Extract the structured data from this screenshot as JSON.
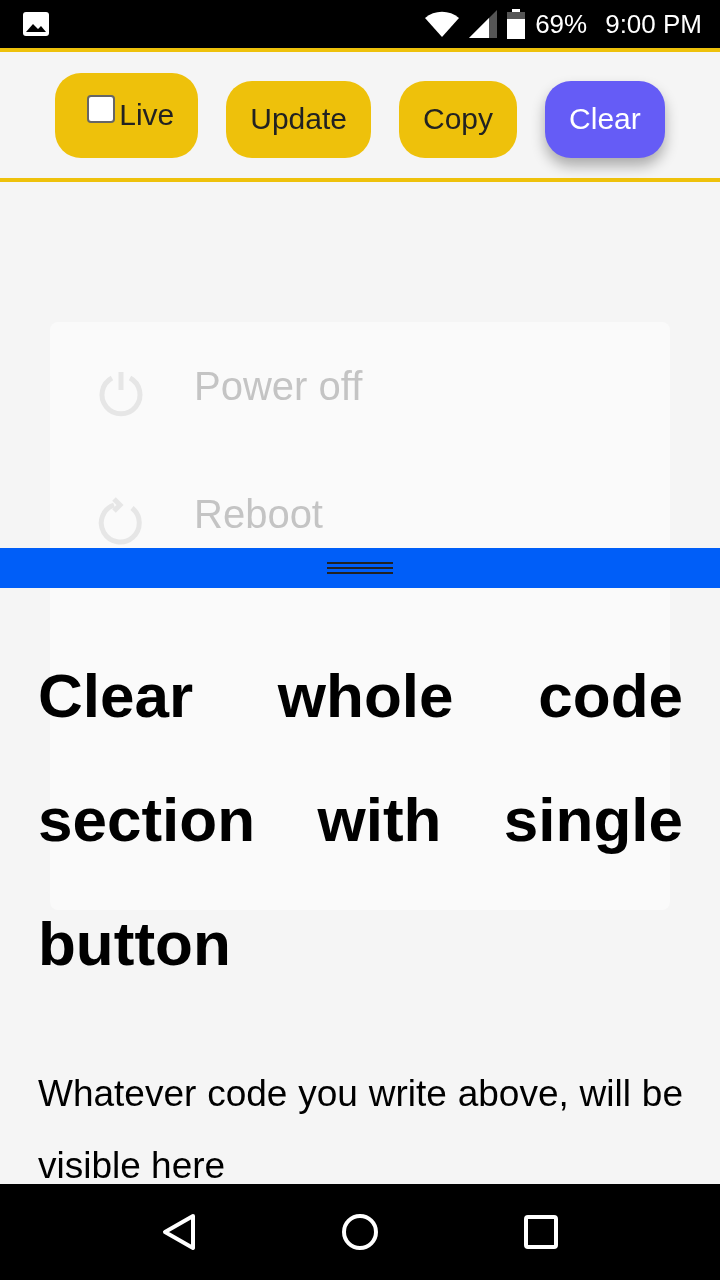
{
  "status_bar": {
    "battery": "69%",
    "time": "9:00 PM"
  },
  "toolbar": {
    "buttons": [
      {
        "kind": "checkbox",
        "label": "Live",
        "checked": false
      },
      {
        "kind": "plain",
        "label": "Update",
        "selected": false
      },
      {
        "kind": "plain",
        "label": "Copy",
        "selected": false
      },
      {
        "kind": "plain",
        "label": "Clear",
        "selected": true
      }
    ]
  },
  "background_dialog": {
    "items": [
      {
        "kind": "power",
        "title": "Power off"
      },
      {
        "kind": "reboot",
        "title": "Reboot"
      }
    ]
  },
  "output": {
    "heading": "Clear whole code section with single button",
    "text": "Whatever code you write above, will be visible here"
  }
}
